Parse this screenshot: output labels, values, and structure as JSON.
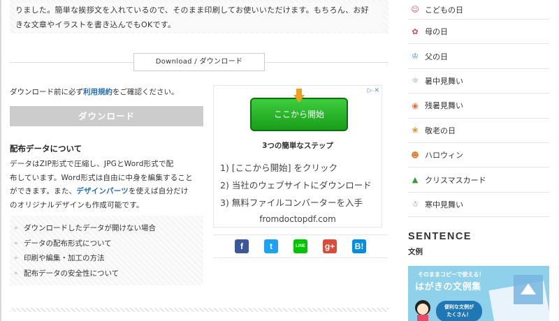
{
  "intro": {
    "line1": "りました。簡単な挨拶文を入れているので、そのまま印刷してお使いいただけます。もちろん、お好",
    "line2": "きな文章やイラストを書き込んでもOKです。"
  },
  "download": {
    "heading": "Download / ダウンロード",
    "terms_prefix": "ダウンロード前に必ず",
    "terms_link": "利用規約",
    "terms_suffix": "をご確認ください。",
    "button": "ダウンロード"
  },
  "about": {
    "title": "配布データについて",
    "line1": "データはZIP形式で圧縮し、JPGとWord形式で配",
    "line2": "布しています。Word形式は自由に中身を編集すること",
    "line3_prefix": "ができます。また、",
    "line3_link": "デザインパーツ",
    "line3_suffix": "を使えば自分だけ",
    "line4": "のオリジナルデザインも作成可能です。"
  },
  "related": [
    "ダウンロードしたデータが開けない場合",
    "データの配布形式について",
    "印刷や編集・加工の方法",
    "配布データの安全性について"
  ],
  "ad": {
    "cta": "ここから開始",
    "subtitle": "3つの簡単なステップ",
    "steps": [
      "1) [ここから開始] をクリック",
      "2) 当社のウェブサイトにダウンロード",
      "3) 無料ファイルコンバーターを入手"
    ],
    "domain": "fromdoctopdf.com",
    "info_icon": "▷",
    "close_icon": "✕"
  },
  "share": {
    "facebook": "f",
    "twitter": "t",
    "line": "LINE",
    "googleplus": "g+",
    "hatena": "B!"
  },
  "sidebar": {
    "items": [
      {
        "label": "こどもの日",
        "icon": "☺",
        "color": "#d94b8a"
      },
      {
        "label": "母の日",
        "icon": "✿",
        "color": "#d9474a"
      },
      {
        "label": "父の日",
        "icon": "♔",
        "color": "#3a8ad0"
      },
      {
        "label": "暑中見舞い",
        "icon": "☼",
        "color": "#4aa0e0"
      },
      {
        "label": "残暑見舞い",
        "icon": "◉",
        "color": "#e0703a"
      },
      {
        "label": "敬老の日",
        "icon": "❀",
        "color": "#e08a2a"
      },
      {
        "label": "ハロウィン",
        "icon": "☻",
        "color": "#e0782a"
      },
      {
        "label": "クリスマスカード",
        "icon": "▲",
        "color": "#3a9a3a"
      },
      {
        "label": "寒中見舞い",
        "icon": "☃",
        "color": "#3a7ac0"
      }
    ],
    "heading": "SENTENCE",
    "subheading": "文例",
    "banner_top": "そのままコピーで使える！",
    "banner_title": "はがきの文例集",
    "banner_bubble1": "便利な文例が",
    "banner_bubble2": "たくさん！"
  },
  "scroll_top_icon": "▲"
}
